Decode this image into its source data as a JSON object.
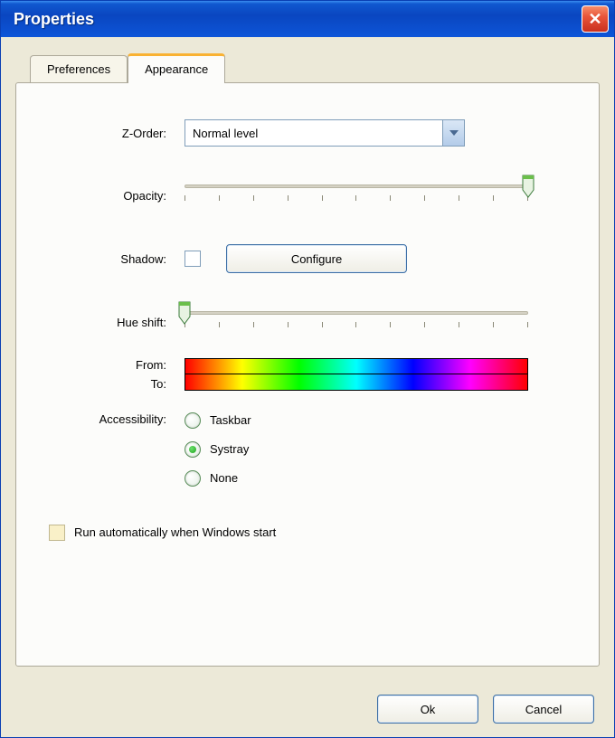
{
  "window": {
    "title": "Properties"
  },
  "tabs": {
    "preferences": "Preferences",
    "appearance": "Appearance",
    "active": "appearance"
  },
  "form": {
    "zorder": {
      "label": "Z-Order:",
      "value": "Normal level"
    },
    "opacity": {
      "label": "Opacity:",
      "value": 10,
      "min": 0,
      "max": 10
    },
    "shadow": {
      "label": "Shadow:",
      "checked": false,
      "configure": "Configure"
    },
    "hueshift": {
      "label": "Hue shift:",
      "value": 0,
      "min": 0,
      "max": 10,
      "from": "From:",
      "to": "To:"
    },
    "accessibility": {
      "label": "Accessibility:",
      "options": [
        {
          "label": "Taskbar",
          "value": "taskbar"
        },
        {
          "label": "Systray",
          "value": "systray"
        },
        {
          "label": "None",
          "value": "none"
        }
      ],
      "selected": "systray"
    },
    "autorun": {
      "label": "Run automatically when Windows start",
      "checked": false
    }
  },
  "buttons": {
    "ok": "Ok",
    "cancel": "Cancel"
  }
}
